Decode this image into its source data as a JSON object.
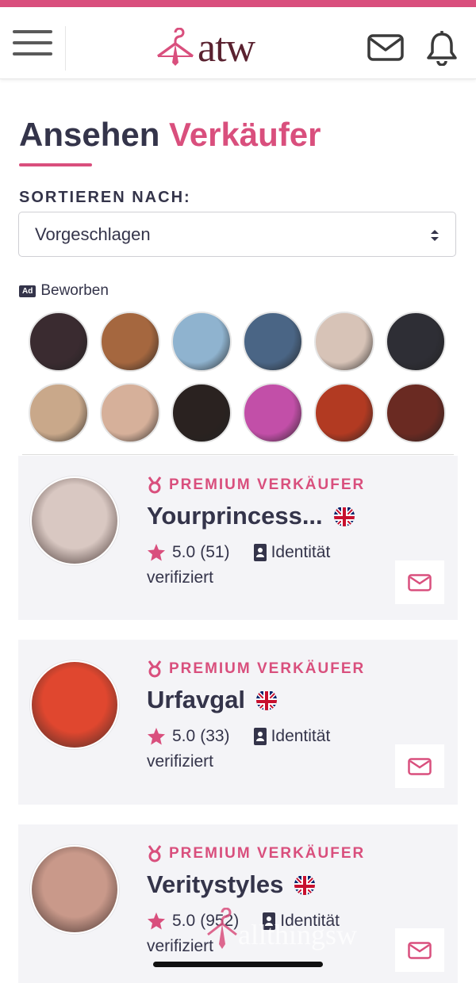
{
  "header": {
    "logo_text": "atw",
    "brand_color": "#d94f7d"
  },
  "page": {
    "title_part1": "Ansehen",
    "title_part2": "Verkäufer"
  },
  "sort": {
    "label": "SORTIEREN NACH:",
    "selected": "Vorgeschlagen"
  },
  "promoted": {
    "ad_badge": "Ad",
    "label": "Beworben",
    "avatars": [
      {
        "color": "#3a2b30"
      },
      {
        "color": "#a5673f"
      },
      {
        "color": "#8fb3cf"
      },
      {
        "color": "#4a6585"
      },
      {
        "color": "#d7c3b7"
      },
      {
        "color": "#2e2e35"
      },
      {
        "color": "#c9a88a"
      },
      {
        "color": "#d6b09a"
      },
      {
        "color": "#2a2220"
      },
      {
        "color": "#c24fa8"
      },
      {
        "color": "#b23a22"
      },
      {
        "color": "#6a2a22"
      }
    ]
  },
  "sellers": [
    {
      "badge": "PREMIUM VERKÄUFER",
      "name": "Yourprincess...",
      "rating": "5.0",
      "count": "(51)",
      "identity1": "Identität",
      "identity2": "verifiziert",
      "avatar_color": "#d9c8c2"
    },
    {
      "badge": "PREMIUM VERKÄUFER",
      "name": "Urfavgal",
      "rating": "5.0",
      "count": "(33)",
      "identity1": "Identität",
      "identity2": "verifiziert",
      "avatar_color": "#e0472f"
    },
    {
      "badge": "PREMIUM VERKÄUFER",
      "name": "Veritystyles",
      "rating": "5.0",
      "count": "(952)",
      "identity1": "Identität",
      "identity2": "verifiziert",
      "avatar_color": "#c9998a"
    }
  ],
  "watermark_text": "allthingsw"
}
